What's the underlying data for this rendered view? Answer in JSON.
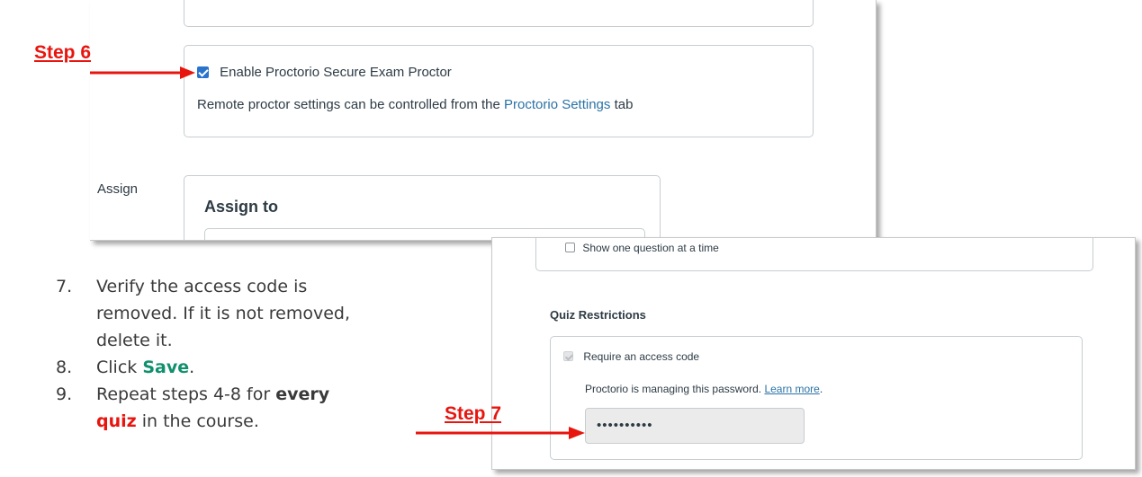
{
  "top_screenshot": {
    "proctor_checkbox_label": "Enable Proctorio Secure Exam Proctor",
    "proctor_hint_prefix": "Remote proctor settings can be controlled from the ",
    "proctor_hint_link": "Proctorio Settings",
    "proctor_hint_suffix": " tab",
    "assign_side_label": "Assign",
    "assign_to_heading": "Assign to"
  },
  "bottom_screenshot": {
    "show_one_question_label": "Show one question at a time",
    "quiz_restrictions_heading": "Quiz Restrictions",
    "access_code_label": "Require an access code",
    "managed_prefix": "Proctorio is managing this password. ",
    "learn_more_link": "Learn more",
    "managed_suffix": ".",
    "password_value": "••••••••••"
  },
  "callouts": {
    "step6": "Step 6",
    "step7": "Step 7",
    "arrow_color": "#e8150f"
  },
  "instructions": [
    {
      "num": "7.",
      "text": "Verify the access code is removed. If it is not removed, delete it."
    },
    {
      "num": "8.",
      "pre": "Click ",
      "highlight": "Save",
      "post": "."
    },
    {
      "num": "9.",
      "pre": "Repeat steps 4-8 for ",
      "bold": "every",
      "mid": " ",
      "red": "quiz",
      "post": " in the course."
    }
  ]
}
